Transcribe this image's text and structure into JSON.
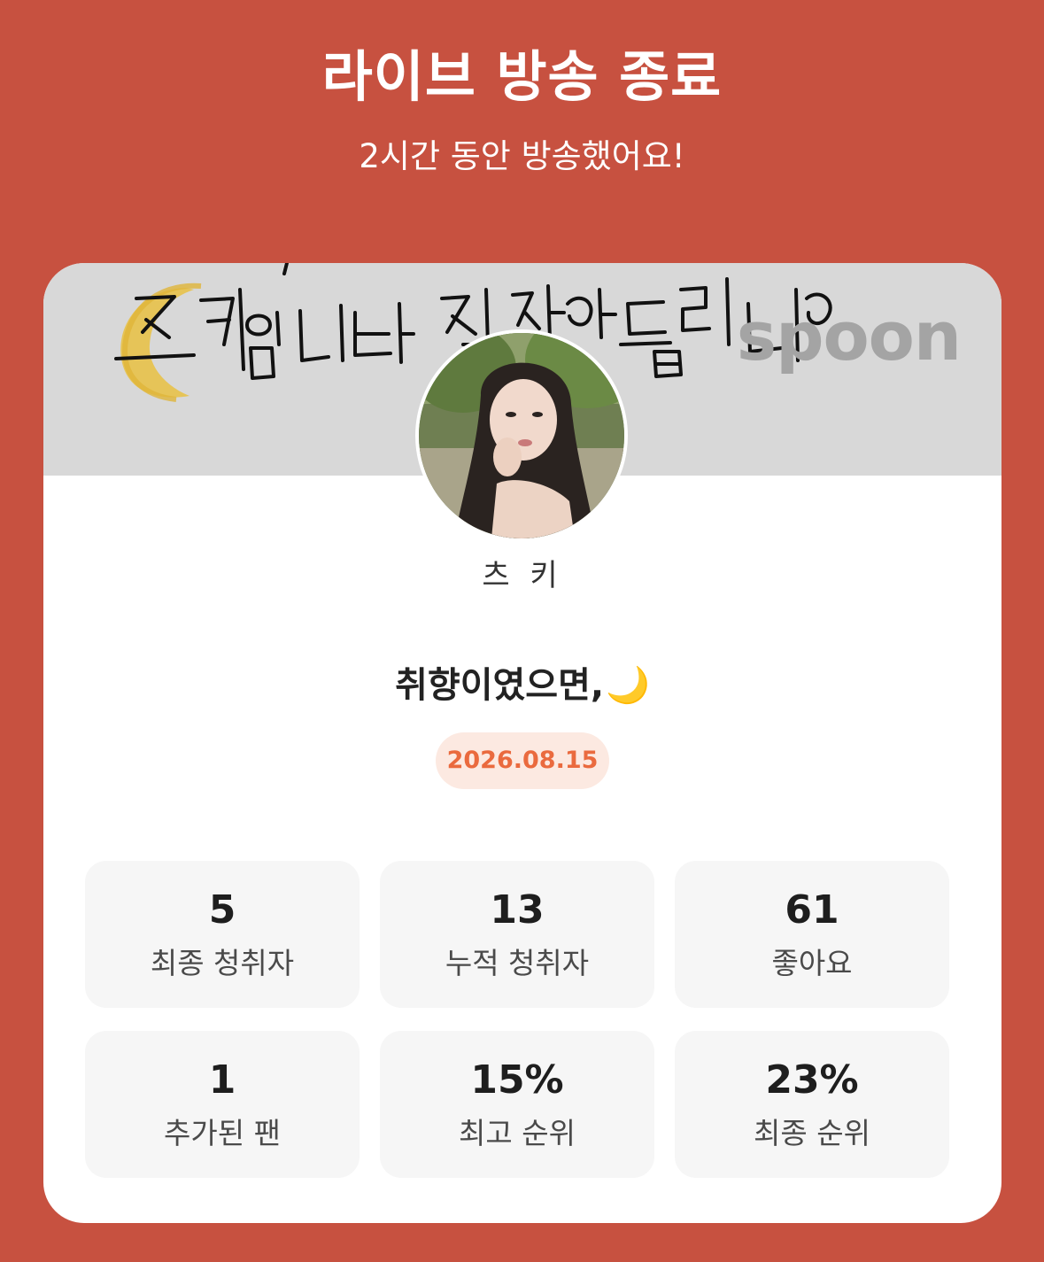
{
  "header": {
    "title": "라이브 방송 종료",
    "subtitle": "2시간 동안 방송했어요!"
  },
  "banner": {
    "logo_text": "spoon"
  },
  "profile": {
    "nickname": "츠 키"
  },
  "live": {
    "title": "취향이였으면,",
    "title_emoji": "🌙",
    "date": "2026.08.15"
  },
  "stats": [
    {
      "value": "5",
      "label": "최종 청취자"
    },
    {
      "value": "13",
      "label": "누적 청취자"
    },
    {
      "value": "61",
      "label": "좋아요"
    },
    {
      "value": "1",
      "label": "추가된 팬"
    },
    {
      "value": "15%",
      "label": "최고 순위"
    },
    {
      "value": "23%",
      "label": "최종 순위"
    }
  ],
  "colors": {
    "background": "#c75140",
    "date_badge_text": "#ea6a3e",
    "date_badge_bg": "#fce9e1",
    "stat_box_bg": "#f6f6f6"
  }
}
